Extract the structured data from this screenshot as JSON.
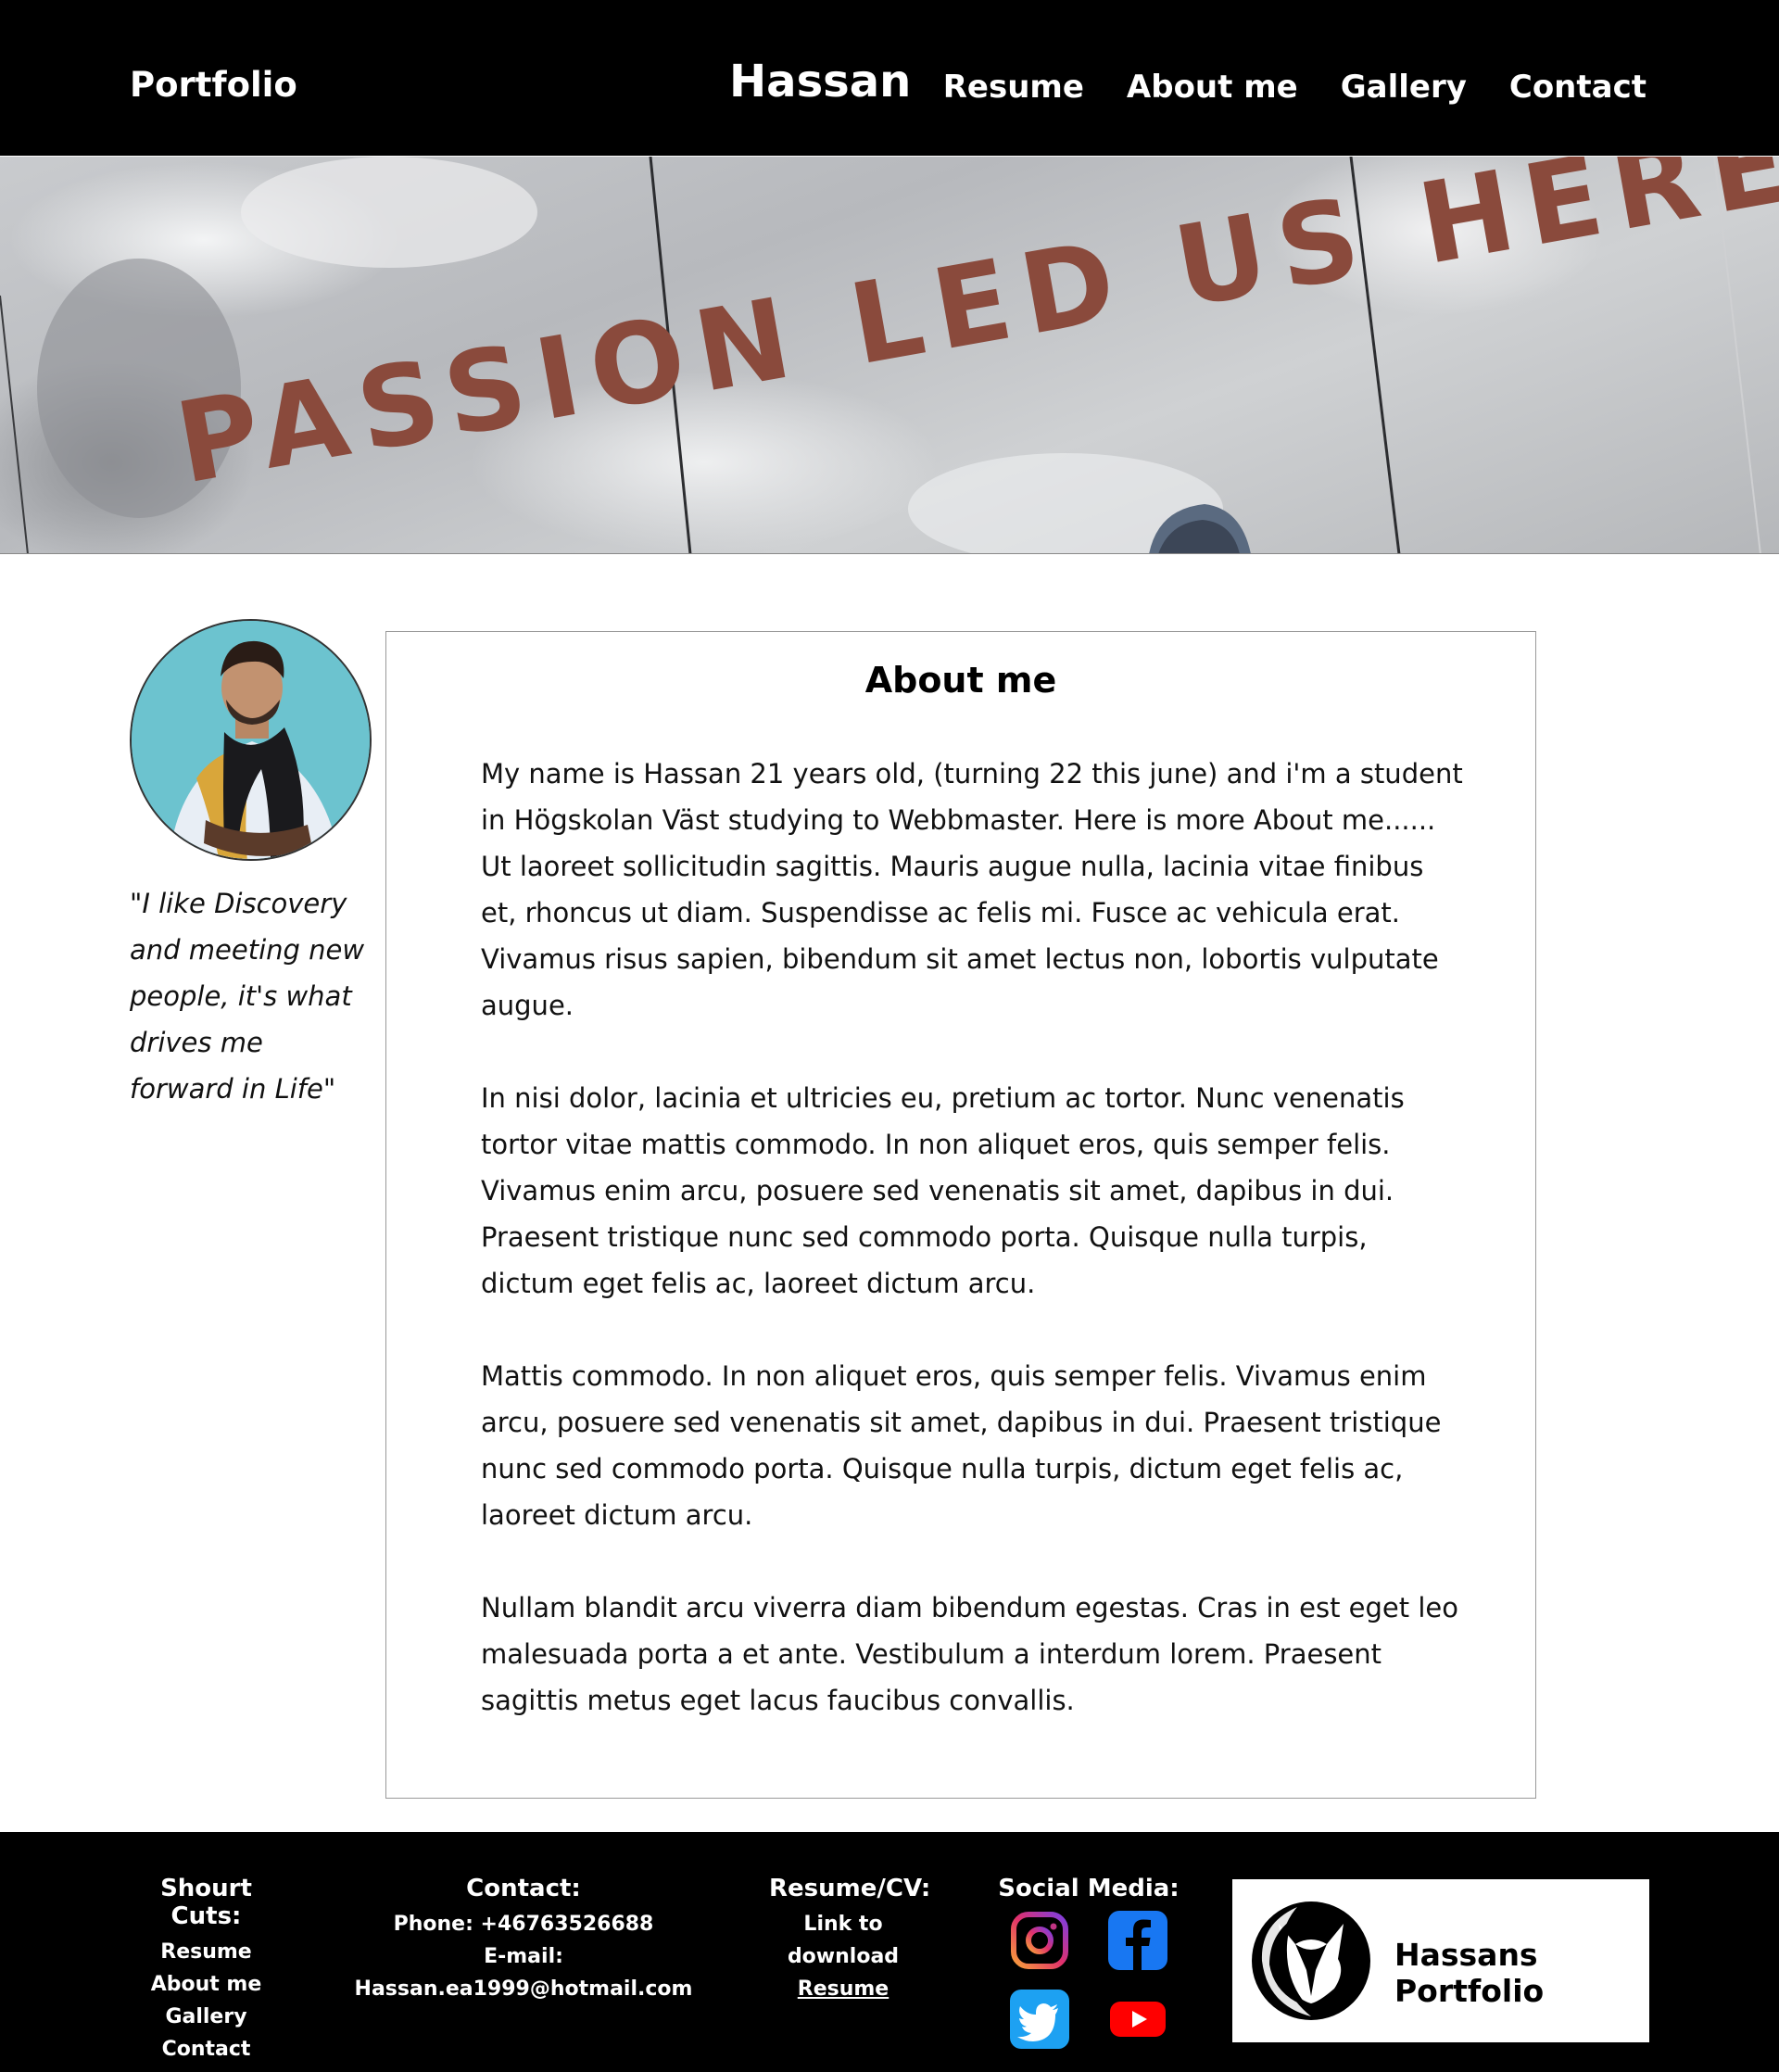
{
  "header": {
    "brand": "Portfolio",
    "site_name": "Hassan",
    "nav": [
      "Resume",
      "About me",
      "Gallery",
      "Contact"
    ]
  },
  "hero": {
    "banner_text": "PASSION LED US HERE"
  },
  "profile": {
    "quote": "\"I like Discovery and meeting new people, it's what drives me forward in Life\""
  },
  "about": {
    "title": "About me",
    "paragraphs": [
      "My name is Hassan 21 years old, (turning 22 this june) and i'm a student in Högskolan Väst studying to Webbmaster. Here is more About me...... Ut laoreet sollicitudin sagittis. Mauris augue nulla, lacinia vitae finibus et, rhoncus ut diam. Suspendisse ac felis mi. Fusce ac vehicula erat. Vivamus risus sapien, bibendum sit amet lectus non, lobortis vulputate augue.",
      "In nisi dolor, lacinia et ultricies eu, pretium ac tortor. Nunc venenatis tortor vitae mattis commodo. In non aliquet eros, quis semper felis. Vivamus enim arcu, posuere sed venenatis sit amet, dapibus in dui. Praesent tristique nunc sed commodo porta. Quisque nulla turpis, dictum eget felis ac, laoreet dictum arcu.",
      "Mattis commodo. In non aliquet eros, quis semper felis. Vivamus enim arcu, posuere sed venenatis sit amet, dapibus in dui. Praesent tristique nunc sed commodo porta. Quisque nulla turpis, dictum eget felis ac, laoreet dictum arcu.",
      "Nullam blandit arcu viverra diam bibendum egestas. Cras in est eget leo malesuada porta a et ante. Vestibulum a interdum lorem. Praesent sagittis metus eget lacus faucibus convallis."
    ],
    "first_line_break": "My name is Hassan 21 years old, (turning 22 this june) and i'm a student in Högskolan Väst studying to Webbmaster. Here is more About me......",
    "first_rest": "Ut laoreet sollicitudin sagittis. Mauris augue nulla, lacinia vitae finibus et, rhoncus ut diam. Suspendisse ac felis mi. Fusce ac vehicula erat. Vivamus risus sapien, bibendum sit amet lectus non, lobortis vulputate augue."
  },
  "footer": {
    "shortcuts": {
      "title": "Shourt Cuts:",
      "links": [
        "Resume",
        "About me",
        "Gallery",
        "Contact"
      ]
    },
    "contact": {
      "title": "Contact:",
      "phone": "Phone: +46763526688",
      "email": "E-mail: Hassan.ea1999@hotmail.com"
    },
    "resume": {
      "title": "Resume/CV:",
      "line1": "Link to",
      "line2": "download",
      "link": "Resume"
    },
    "social": {
      "title": "Social Media:",
      "icons": [
        "instagram-icon",
        "facebook-icon",
        "twitter-icon",
        "youtube-icon"
      ]
    },
    "logo_text": "Hassans Portfolio"
  },
  "colors": {
    "header_bg": "#000000",
    "footer_bg": "#000000",
    "banner_letters": "#8a4a3c",
    "avatar_bg": "#6cc3cf"
  }
}
